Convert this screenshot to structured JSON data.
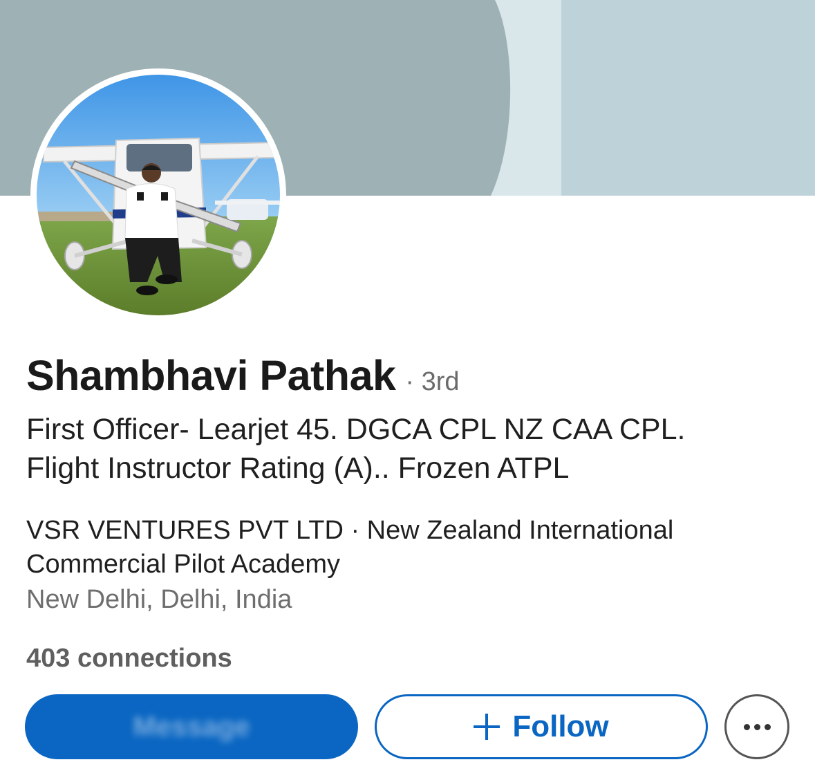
{
  "profile": {
    "name": "Shambhavi Pathak",
    "degree": "· 3rd",
    "headline_line1": "First Officer- Learjet 45. DGCA CPL NZ CAA CPL.",
    "headline_line2": "Flight Instructor Rating (A).. Frozen ATPL",
    "company": "VSR VENTURES PVT LTD · New Zealand International Commercial Pilot Academy",
    "location": "New Delhi, Delhi, India",
    "connections": "403 connections"
  },
  "actions": {
    "message_label": "Message",
    "follow_label": "Follow",
    "more_icon": "ellipsis-icon",
    "follow_icon": "plus-icon"
  },
  "colors": {
    "primary": "#0a66c2",
    "banner_gray": "#9eb1b5",
    "banner_light": "#bed3d9"
  }
}
